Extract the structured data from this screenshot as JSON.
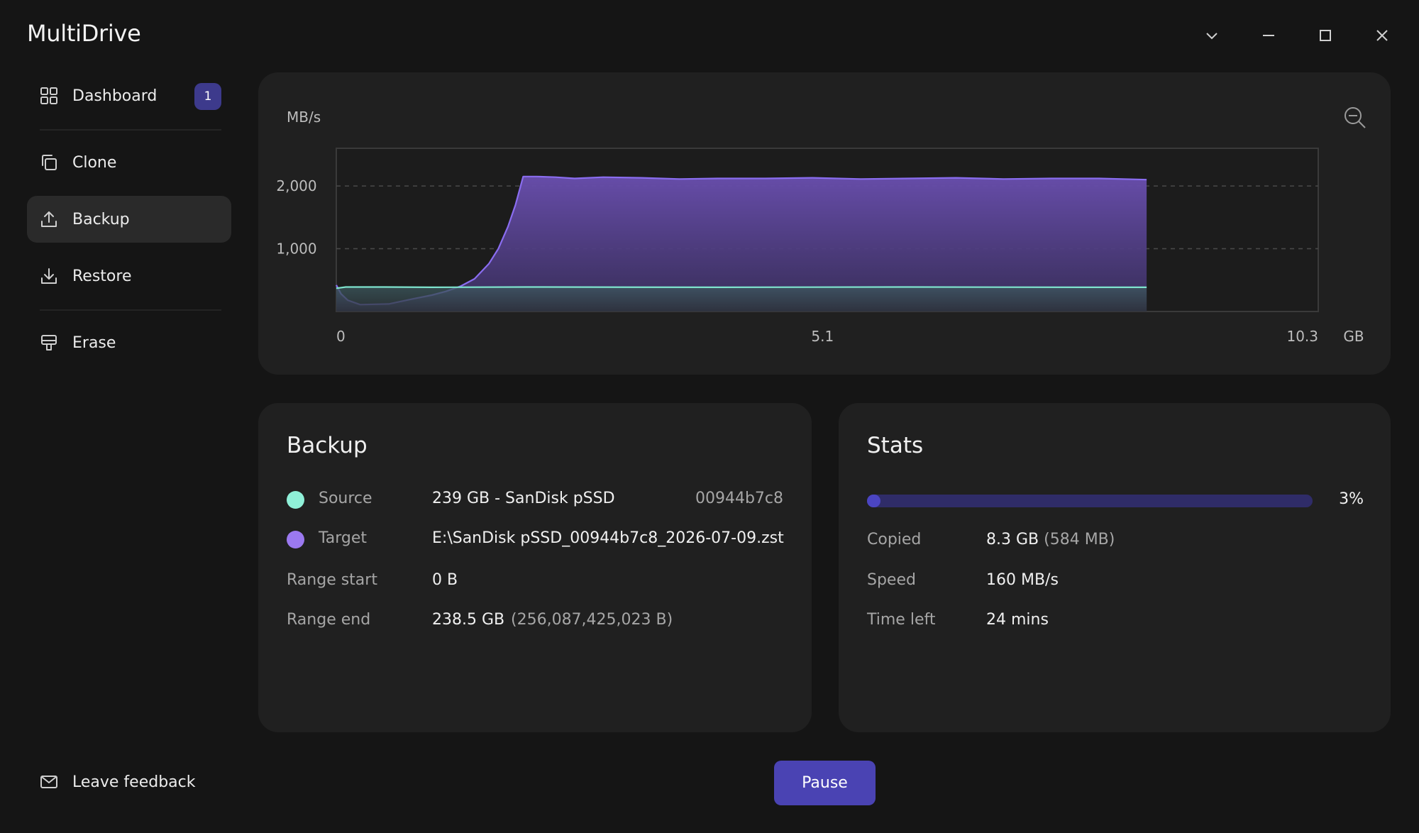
{
  "app": {
    "title": "MultiDrive"
  },
  "sidebar": {
    "items": [
      {
        "label": "Dashboard",
        "badge": "1"
      },
      {
        "label": "Clone"
      },
      {
        "label": "Backup"
      },
      {
        "label": "Restore"
      },
      {
        "label": "Erase"
      }
    ],
    "active": "Backup",
    "feedback_label": "Leave feedback"
  },
  "chart_data": {
    "type": "area",
    "ylabel": "MB/s",
    "xlabel": "GB",
    "x_ticks": [
      "0",
      "5.1",
      "10.3"
    ],
    "y_ticks": [
      "1,000",
      "2,000"
    ],
    "xlim": [
      0,
      10.3
    ],
    "ylim": [
      0,
      2600
    ],
    "grid": "horizontal-dashed",
    "series": [
      {
        "color": "#8a6df0",
        "x": [
          0,
          0.05,
          0.12,
          0.25,
          0.55,
          0.8,
          1.0,
          1.15,
          1.3,
          1.45,
          1.6,
          1.7,
          1.8,
          1.88,
          1.96,
          2.1,
          2.3,
          2.5,
          2.8,
          3.2,
          3.6,
          4.0,
          4.5,
          5.0,
          5.5,
          6.0,
          6.5,
          7.0,
          7.5,
          8.0,
          8.5
        ],
        "y": [
          420,
          280,
          180,
          110,
          120,
          200,
          260,
          320,
          400,
          520,
          760,
          1000,
          1350,
          1700,
          2150,
          2150,
          2140,
          2120,
          2140,
          2130,
          2110,
          2120,
          2120,
          2130,
          2110,
          2120,
          2130,
          2110,
          2120,
          2120,
          2100
        ]
      },
      {
        "color": "#7ee3cd",
        "x": [
          0,
          0.1,
          0.5,
          1.0,
          2.0,
          4.0,
          6.0,
          8.0,
          8.5
        ],
        "y": [
          370,
          390,
          390,
          385,
          390,
          385,
          390,
          385,
          385
        ]
      }
    ]
  },
  "backup": {
    "title": "Backup",
    "source_label": "Source",
    "source_value": "239 GB - SanDisk pSSD",
    "source_id": "00944b7c8",
    "source_color": "#8ff0d8",
    "target_label": "Target",
    "target_value": "E:\\SanDisk pSSD_00944b7c8_2026-07-09.zst",
    "target_color": "#9b79f0",
    "range_start_label": "Range start",
    "range_start_value": "0 B",
    "range_end_label": "Range end",
    "range_end_value": "238.5 GB",
    "range_end_bytes": "(256,087,425,023 B)"
  },
  "stats": {
    "title": "Stats",
    "progress_percent": 3,
    "progress_label": "3%",
    "copied_label": "Copied",
    "copied_value": "8.3 GB",
    "copied_extra": "(584 MB)",
    "speed_label": "Speed",
    "speed_value": "160 MB/s",
    "time_left_label": "Time left",
    "time_left_value": "24 mins"
  },
  "actions": {
    "pause_label": "Pause"
  },
  "icons": {
    "window": [
      "chevron-down-icon",
      "minimize-icon",
      "maximize-icon",
      "close-icon"
    ],
    "zoom": "zoom-out-icon"
  }
}
